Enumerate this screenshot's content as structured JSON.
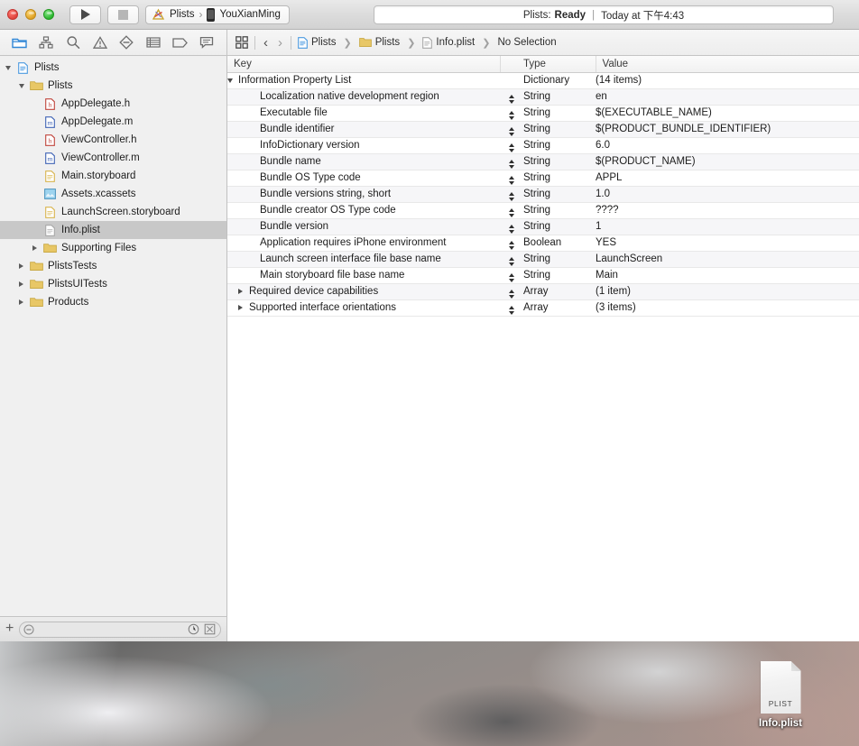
{
  "window": {
    "traffic_lights": [
      "close",
      "minimize",
      "zoom"
    ],
    "toolbar": {
      "run_label": "Run",
      "stop_label": "Stop",
      "scheme_project": "Plists",
      "scheme_destination": "YouXianMing",
      "scheme_separator": "›"
    },
    "status": {
      "project": "Plists:",
      "state": "Ready",
      "separator": "|",
      "timestamp": "Today at 下午4:43"
    }
  },
  "navigator_tabs": [
    {
      "name": "project-navigator",
      "icon": "folder-icon",
      "active": true
    },
    {
      "name": "source-control-navigator",
      "icon": "source-control-icon",
      "active": false
    },
    {
      "name": "symbol-navigator",
      "icon": "search-icon",
      "active": false
    },
    {
      "name": "issue-navigator",
      "icon": "warning-triangle-icon",
      "active": false
    },
    {
      "name": "test-navigator",
      "icon": "test-diamond-icon",
      "active": false
    },
    {
      "name": "debug-navigator",
      "icon": "debug-list-icon",
      "active": false
    },
    {
      "name": "breakpoint-navigator",
      "icon": "breakpoint-tag-icon",
      "active": false
    },
    {
      "name": "report-navigator",
      "icon": "report-bubble-icon",
      "active": false
    }
  ],
  "jumpbar": {
    "related_items_icon": "related-items-icon",
    "back_label": "‹",
    "forward_label": "›",
    "crumbs": [
      {
        "label": "Plists",
        "icon": "project-file-icon"
      },
      {
        "label": "Plists",
        "icon": "folder-icon"
      },
      {
        "label": "Info.plist",
        "icon": "plist-file-icon"
      },
      {
        "label": "No Selection",
        "icon": "none"
      }
    ],
    "chevron": "❯"
  },
  "navigator": {
    "items": [
      {
        "label": "Plists",
        "icon": "project-file-icon",
        "depth": 0,
        "twisty": "open",
        "selected": false
      },
      {
        "label": "Plists",
        "icon": "folder-icon",
        "depth": 1,
        "twisty": "open",
        "selected": false
      },
      {
        "label": "AppDelegate.h",
        "icon": "header-file-icon",
        "depth": 2,
        "twisty": "none",
        "selected": false
      },
      {
        "label": "AppDelegate.m",
        "icon": "objc-file-icon",
        "depth": 2,
        "twisty": "none",
        "selected": false
      },
      {
        "label": "ViewController.h",
        "icon": "header-file-icon",
        "depth": 2,
        "twisty": "none",
        "selected": false
      },
      {
        "label": "ViewController.m",
        "icon": "objc-file-icon",
        "depth": 2,
        "twisty": "none",
        "selected": false
      },
      {
        "label": "Main.storyboard",
        "icon": "storyboard-file-icon",
        "depth": 2,
        "twisty": "none",
        "selected": false
      },
      {
        "label": "Assets.xcassets",
        "icon": "xcassets-icon",
        "depth": 2,
        "twisty": "none",
        "selected": false
      },
      {
        "label": "LaunchScreen.storyboard",
        "icon": "storyboard-file-icon",
        "depth": 2,
        "twisty": "none",
        "selected": false
      },
      {
        "label": "Info.plist",
        "icon": "plist-file-icon",
        "depth": 2,
        "twisty": "none",
        "selected": true
      },
      {
        "label": "Supporting Files",
        "icon": "folder-icon",
        "depth": 2,
        "twisty": "closed",
        "selected": false
      },
      {
        "label": "PlistsTests",
        "icon": "folder-icon",
        "depth": 1,
        "twisty": "closed",
        "selected": false
      },
      {
        "label": "PlistsUITests",
        "icon": "folder-icon",
        "depth": 1,
        "twisty": "closed",
        "selected": false
      },
      {
        "label": "Products",
        "icon": "folder-icon",
        "depth": 1,
        "twisty": "closed",
        "selected": false
      }
    ],
    "filter": {
      "add_label": "+",
      "placeholder": "",
      "value": "",
      "recent_icon": "clock-icon",
      "sourcecontrol_icon": "filter-status-icon"
    }
  },
  "plist": {
    "columns": [
      "Key",
      "Type",
      "Value"
    ],
    "rows": [
      {
        "key": "Information Property List",
        "type": "Dictionary",
        "value": "(14 items)",
        "depth": 0,
        "twisty": "open",
        "stepper": false,
        "value_muted": true
      },
      {
        "key": "Localization native development region",
        "type": "String",
        "value": "en",
        "depth": 1,
        "twisty": "none",
        "stepper": true,
        "value_muted": false
      },
      {
        "key": "Executable file",
        "type": "String",
        "value": "$(EXECUTABLE_NAME)",
        "depth": 1,
        "twisty": "none",
        "stepper": true,
        "value_muted": false
      },
      {
        "key": "Bundle identifier",
        "type": "String",
        "value": "$(PRODUCT_BUNDLE_IDENTIFIER)",
        "depth": 1,
        "twisty": "none",
        "stepper": true,
        "value_muted": false
      },
      {
        "key": "InfoDictionary version",
        "type": "String",
        "value": "6.0",
        "depth": 1,
        "twisty": "none",
        "stepper": true,
        "value_muted": false
      },
      {
        "key": "Bundle name",
        "type": "String",
        "value": "$(PRODUCT_NAME)",
        "depth": 1,
        "twisty": "none",
        "stepper": true,
        "value_muted": false
      },
      {
        "key": "Bundle OS Type code",
        "type": "String",
        "value": "APPL",
        "depth": 1,
        "twisty": "none",
        "stepper": true,
        "value_muted": false
      },
      {
        "key": "Bundle versions string, short",
        "type": "String",
        "value": "1.0",
        "depth": 1,
        "twisty": "none",
        "stepper": true,
        "value_muted": false
      },
      {
        "key": "Bundle creator OS Type code",
        "type": "String",
        "value": "????",
        "depth": 1,
        "twisty": "none",
        "stepper": true,
        "value_muted": false
      },
      {
        "key": "Bundle version",
        "type": "String",
        "value": "1",
        "depth": 1,
        "twisty": "none",
        "stepper": true,
        "value_muted": false
      },
      {
        "key": "Application requires iPhone environment",
        "type": "Boolean",
        "value": "YES",
        "depth": 1,
        "twisty": "none",
        "stepper": true,
        "value_muted": false
      },
      {
        "key": "Launch screen interface file base name",
        "type": "String",
        "value": "LaunchScreen",
        "depth": 1,
        "twisty": "none",
        "stepper": true,
        "value_muted": false
      },
      {
        "key": "Main storyboard file base name",
        "type": "String",
        "value": "Main",
        "depth": 1,
        "twisty": "none",
        "stepper": true,
        "value_muted": false
      },
      {
        "key": "Required device capabilities",
        "type": "Array",
        "value": "(1 item)",
        "depth": 1,
        "twisty": "closed",
        "stepper": true,
        "value_muted": true
      },
      {
        "key": "Supported interface orientations",
        "type": "Array",
        "value": "(3 items)",
        "depth": 1,
        "twisty": "closed",
        "stepper": true,
        "value_muted": true
      }
    ]
  },
  "desktop": {
    "icon": {
      "label": "Info.plist",
      "doc_type": "PLIST"
    }
  },
  "colors": {
    "selection": "#c8c8c8",
    "muted_text": "#9a9a9a",
    "folder": "#e8c766",
    "accent_blue": "#4b9ae0"
  }
}
